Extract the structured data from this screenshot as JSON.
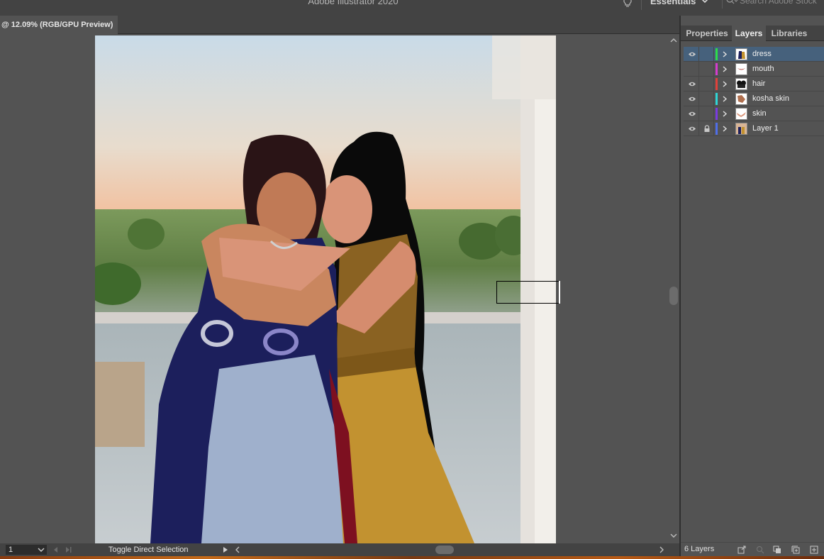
{
  "app": {
    "title": "Adobe Illustrator 2020",
    "workspace": "Essentials",
    "stock_placeholder": "Search Adobe Stock"
  },
  "document_tab": {
    "label": "@ 12.09% (RGB/GPU Preview)"
  },
  "panel": {
    "tabs": [
      {
        "label": "Properties",
        "active": false
      },
      {
        "label": "Layers",
        "active": true
      },
      {
        "label": "Libraries",
        "active": false
      }
    ],
    "layers": [
      {
        "name": "dress",
        "visible": true,
        "locked": false,
        "color": "#2ddc4a",
        "selected": true
      },
      {
        "name": "mouth",
        "visible": false,
        "locked": false,
        "color": "#d43ccf",
        "selected": false
      },
      {
        "name": "hair",
        "visible": true,
        "locked": false,
        "color": "#e0413b",
        "selected": false
      },
      {
        "name": "kosha skin",
        "visible": true,
        "locked": false,
        "color": "#2fd6d6",
        "selected": false
      },
      {
        "name": "skin",
        "visible": true,
        "locked": false,
        "color": "#7a3be0",
        "selected": false
      },
      {
        "name": "Layer 1",
        "visible": true,
        "locked": true,
        "color": "#4f6ee8",
        "selected": false
      }
    ],
    "layer_count": "6 Layers"
  },
  "statusbar": {
    "page": "1",
    "status_text": "Toggle Direct Selection"
  },
  "colors": {
    "ui_dark": "#434343",
    "ui_mid": "#535353",
    "selection": "#46617c",
    "navy_dress": "#1c1f5c",
    "gold_dress": "#c29230",
    "skin_left": "#c07a56",
    "skin_right": "#d99478"
  }
}
